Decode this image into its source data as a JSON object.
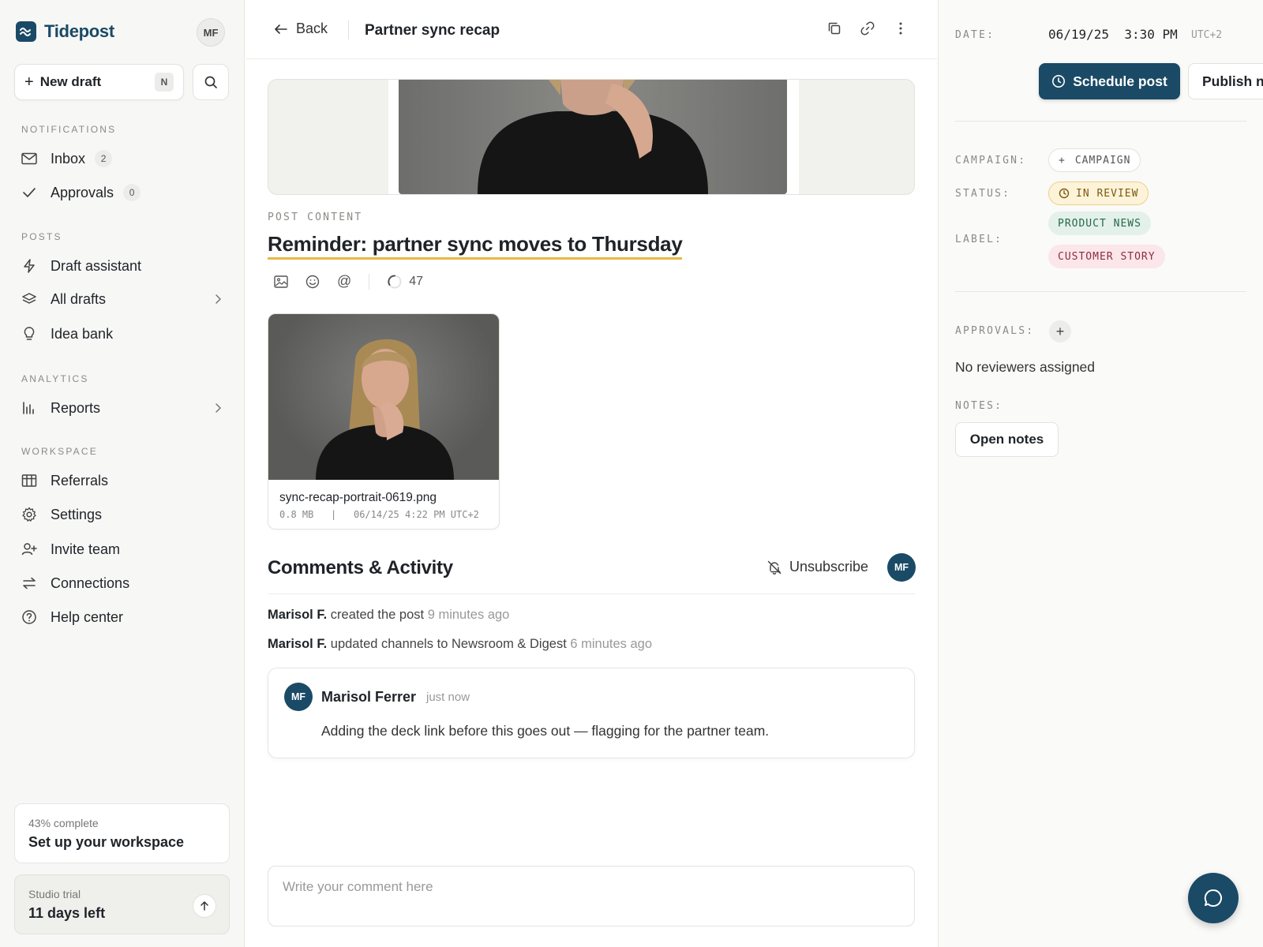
{
  "brand": {
    "name": "Tidepost",
    "user_initials": "MF"
  },
  "sidebar": {
    "new_draft": {
      "label": "New draft",
      "shortcut": "N"
    },
    "sections": {
      "notifications": "NOTIFICATIONS",
      "posts": "POSTS",
      "analytics": "ANALYTICS",
      "workspace": "WORKSPACE"
    },
    "items": {
      "inbox": {
        "label": "Inbox",
        "count": "2"
      },
      "approvals": {
        "label": "Approvals",
        "count": "0"
      },
      "draft_assistant": {
        "label": "Draft assistant"
      },
      "all_drafts": {
        "label": "All drafts"
      },
      "idea_bank": {
        "label": "Idea bank"
      },
      "reports": {
        "label": "Reports"
      },
      "referrals": {
        "label": "Referrals"
      },
      "settings": {
        "label": "Settings"
      },
      "invite_team": {
        "label": "Invite team"
      },
      "connections": {
        "label": "Connections"
      },
      "help_center": {
        "label": "Help center"
      }
    },
    "setup": {
      "progress": "43% complete",
      "title": "Set up your workspace"
    },
    "trial": {
      "label": "Studio trial",
      "remaining": "11 days left"
    }
  },
  "header": {
    "back_label": "Back",
    "title": "Partner sync recap"
  },
  "post": {
    "section_label": "POST CONTENT",
    "title": "Reminder: partner sync moves to Thursday",
    "char_count": "47",
    "attachment": {
      "filename": "sync-recap-portrait-0619.png",
      "size": "0.8 MB",
      "separator": "|",
      "uploaded": "06/14/25 4:22 PM UTC+2"
    }
  },
  "comments": {
    "title": "Comments & Activity",
    "unsubscribe_label": "Unsubscribe",
    "user_initials": "MF",
    "activity": [
      {
        "actor": "Marisol F.",
        "action": "created the post",
        "time": "9 minutes ago"
      },
      {
        "actor": "Marisol F.",
        "action": "updated channels to Newsroom & Digest",
        "time": "6 minutes ago"
      }
    ],
    "comment": {
      "initials": "MF",
      "author": "Marisol Ferrer",
      "time": "just now",
      "text": "Adding the deck link before this goes out — flagging for the partner team."
    },
    "input_placeholder": "Write your comment here"
  },
  "details": {
    "date_label": "DATE:",
    "date_value": "06/19/25  3:30 PM",
    "timezone": "UTC+2",
    "schedule_label": "Schedule post",
    "publish_label": "Publish now",
    "campaign_label": "CAMPAIGN:",
    "campaign_add": "CAMPAIGN",
    "status_label": "STATUS:",
    "status_value": "IN REVIEW",
    "label_label": "LABEL:",
    "labels": [
      "PRODUCT NEWS",
      "CUSTOMER STORY"
    ],
    "approvals_label": "APPROVALS:",
    "no_reviewers": "No reviewers assigned",
    "notes_label": "NOTES:",
    "open_notes": "Open notes"
  },
  "colors": {
    "brand": "#1a4a66",
    "status_review": "#fdf3d9",
    "label_product_news": "#e3f1ea",
    "label_customer_story": "#fbe6ea",
    "title_underline": "#e8b84a"
  }
}
